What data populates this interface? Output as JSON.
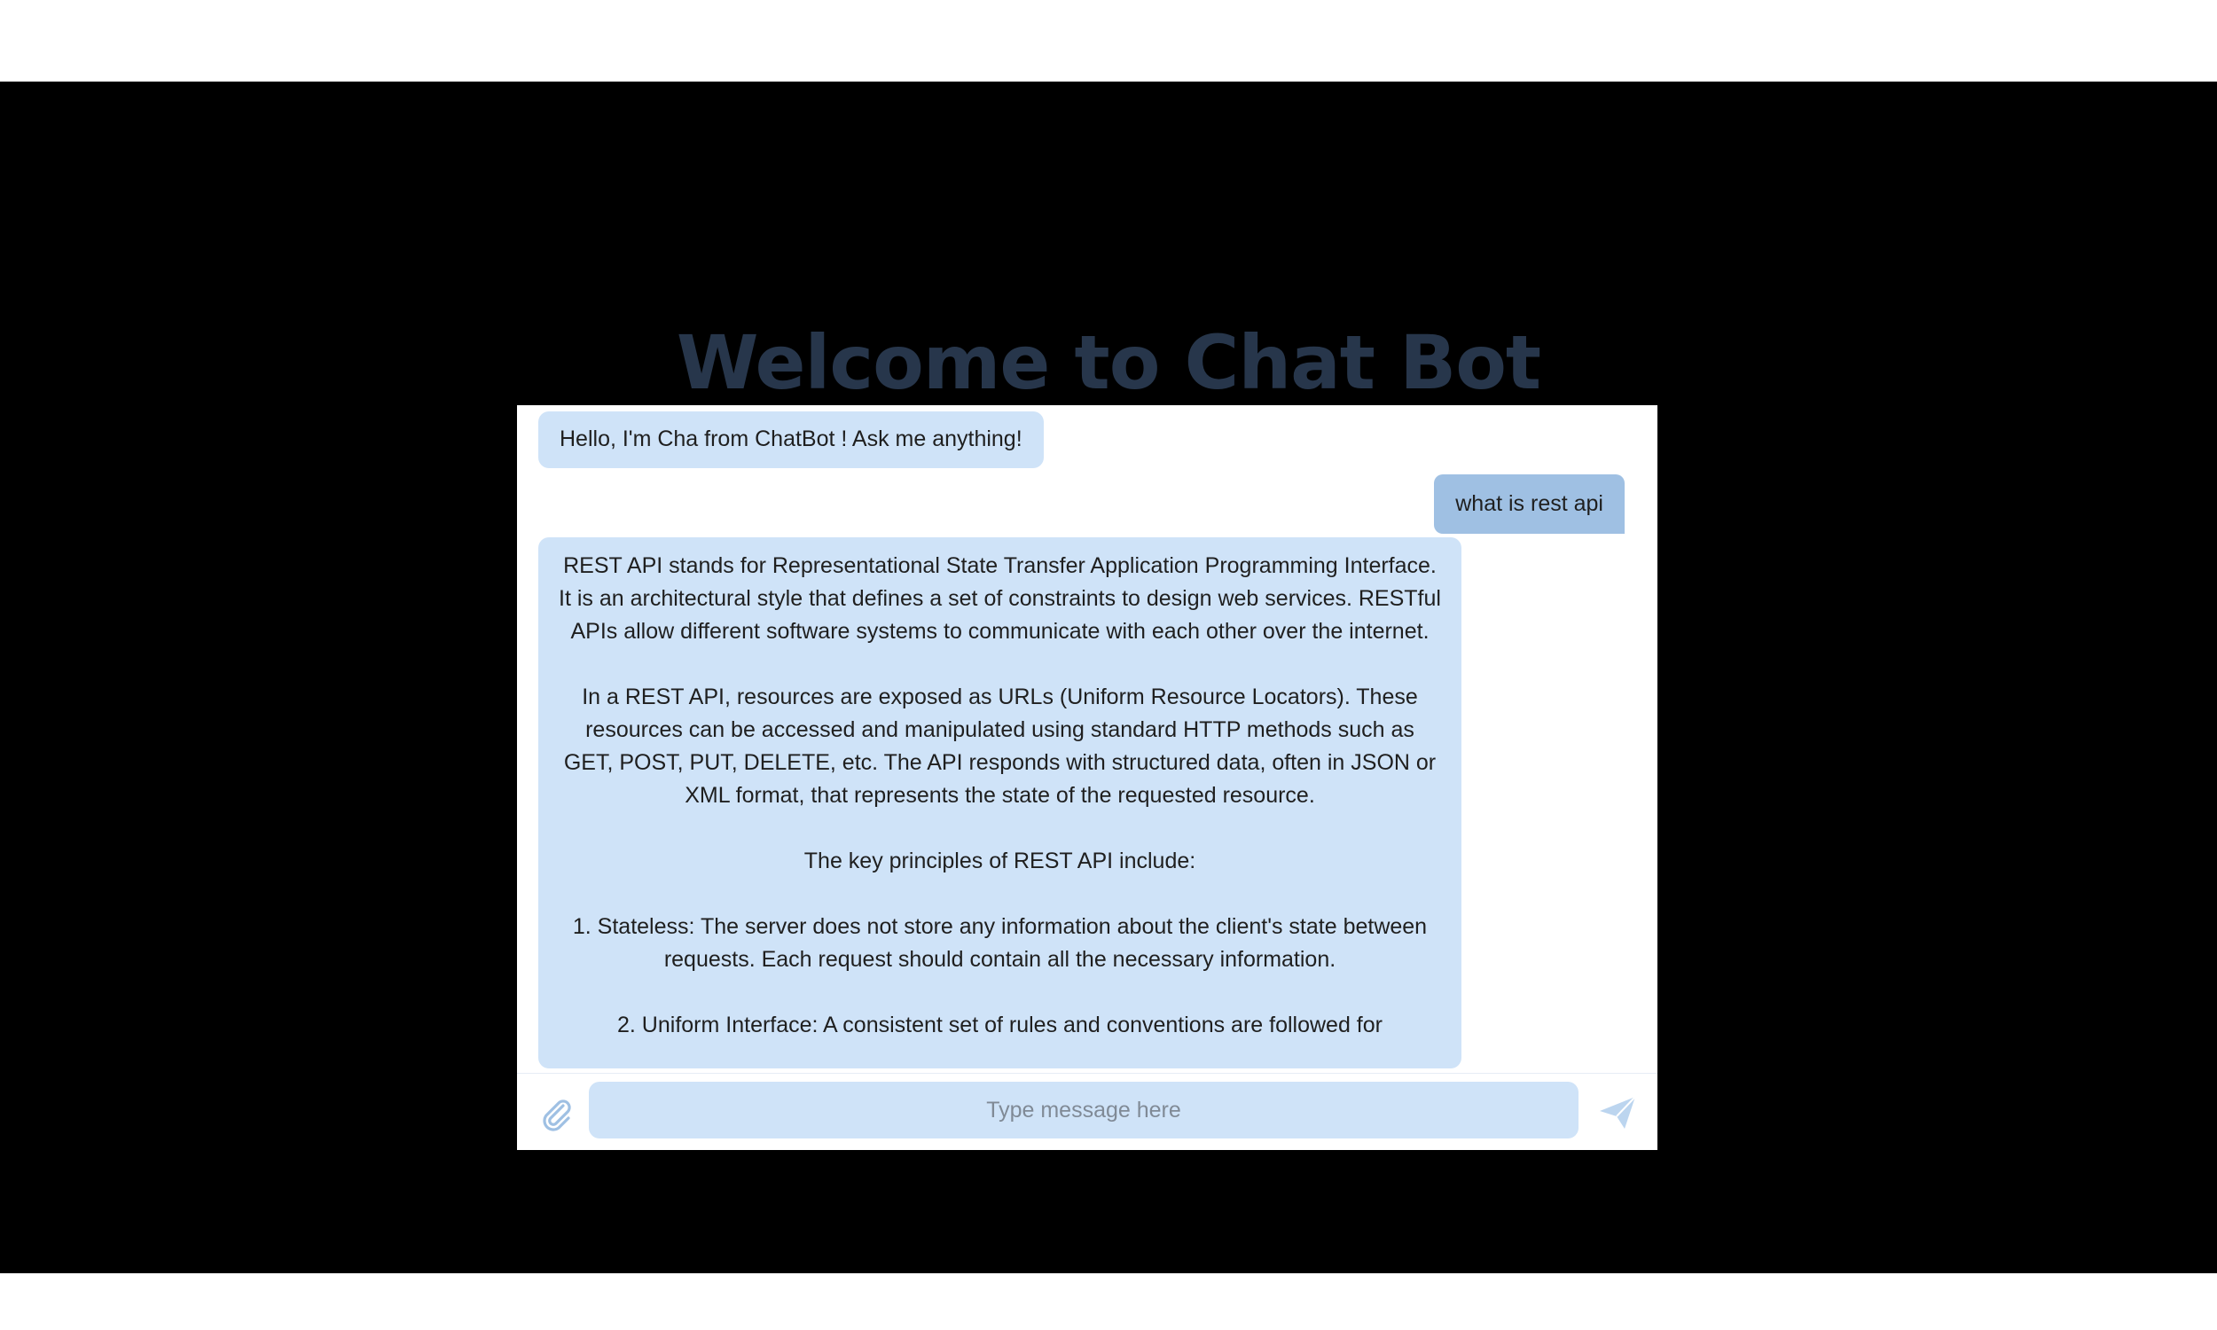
{
  "header": {
    "title": "Welcome to Chat Bot"
  },
  "chat": {
    "messages": [
      {
        "sender": "bot",
        "text": "Hello, I'm Cha from ChatBot ! Ask me anything!"
      },
      {
        "sender": "user",
        "text": "what is rest api"
      },
      {
        "sender": "bot",
        "text": "REST API stands for Representational State Transfer Application Programming Interface. It is an architectural style that defines a set of constraints to design web services. RESTful APIs allow different software systems to communicate with each other over the internet.\n\nIn a REST API, resources are exposed as URLs (Uniform Resource Locators). These resources can be accessed and manipulated using standard HTTP methods such as GET, POST, PUT, DELETE, etc. The API responds with structured data, often in JSON or XML format, that represents the state of the requested resource.\n\nThe key principles of REST API include:\n\n1. Stateless: The server does not store any information about the client's state between requests. Each request should contain all the necessary information.\n\n2. Uniform Interface: A consistent set of rules and conventions are followed for"
      }
    ]
  },
  "input_bar": {
    "placeholder": "Type message here",
    "value": "",
    "attach_icon": "paperclip-icon",
    "send_icon": "send-icon"
  },
  "colors": {
    "page_background": "#000000",
    "title": "#27364b",
    "bot_bubble": "#cfe3f8",
    "user_bubble": "#9fc0e3",
    "icon": "#9fc0e3"
  }
}
